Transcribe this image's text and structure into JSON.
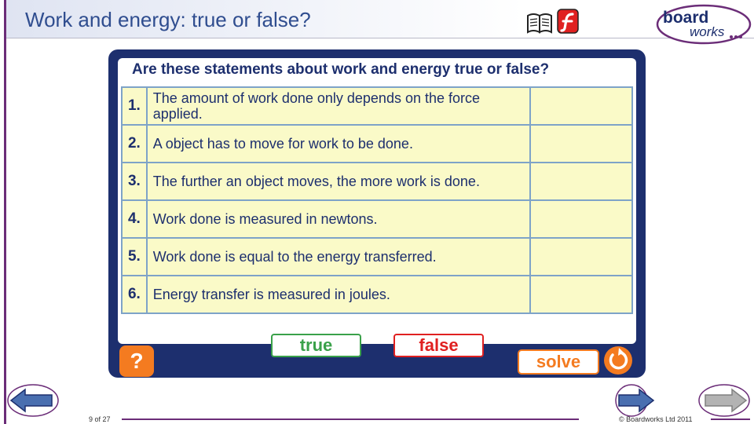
{
  "slide": {
    "title": "Work and energy: true or false?",
    "page_indicator": "9 of 27",
    "copyright": "© Boardworks Ltd 2011"
  },
  "logo": {
    "line1": "board",
    "line2": "works"
  },
  "activity": {
    "question": "Are these statements about work and energy true or false?",
    "statements": [
      {
        "number": "1.",
        "text": "The amount of work done only depends on the force applied.",
        "answer": ""
      },
      {
        "number": "2.",
        "text": "A object has to move for work to be done.",
        "answer": ""
      },
      {
        "number": "3.",
        "text": "The further an object moves, the more work is done.",
        "answer": ""
      },
      {
        "number": "4.",
        "text": "Work done is measured in newtons.",
        "answer": ""
      },
      {
        "number": "5.",
        "text": "Work done is equal to the energy transferred.",
        "answer": ""
      },
      {
        "number": "6.",
        "text": "Energy transfer is measured in joules.",
        "answer": ""
      }
    ],
    "true_label": "true",
    "false_label": "false",
    "help_label": "?",
    "solve_label": "solve"
  },
  "icons": {
    "book": "book-icon",
    "flash": "flash-icon",
    "help": "help-icon",
    "reset": "reset-icon",
    "back": "back-arrow-icon",
    "next": "next-arrow-icon"
  },
  "colors": {
    "panel": "#1d2f6e",
    "cell_fill": "#fafac8",
    "cell_border": "#7ea3c8",
    "true": "#3aa14a",
    "false": "#e02020",
    "accent": "#f47b20",
    "title": "#2f4d8f",
    "rule": "#6b2d78"
  }
}
